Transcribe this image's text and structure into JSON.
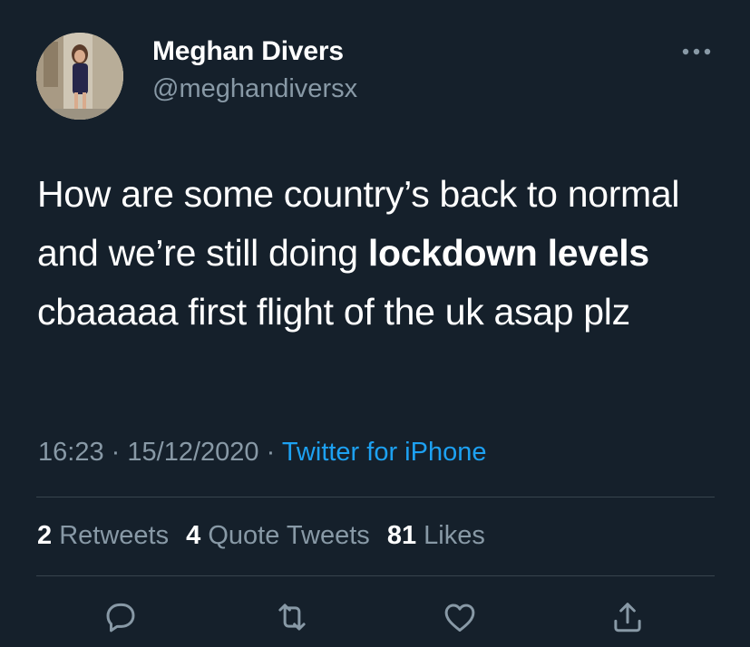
{
  "author": {
    "display_name": "Meghan Divers",
    "handle": "@meghandiversx",
    "avatar_icon": "profile-photo"
  },
  "tweet": {
    "text_segments": [
      {
        "text": "How are some country’s back to normal and we’re still doing ",
        "bold": false
      },
      {
        "text": "lockdown levels",
        "bold": true
      },
      {
        "text": " cbaaaaa first flight of the uk asap plz",
        "bold": false
      }
    ]
  },
  "meta": {
    "time": "16:23",
    "separator": "·",
    "date": "15/12/2020",
    "source": "Twitter for iPhone"
  },
  "stats": {
    "retweets_count": "2",
    "retweets_label": "Retweets",
    "quotes_count": "4",
    "quotes_label": "Quote Tweets",
    "likes_count": "81",
    "likes_label": "Likes"
  },
  "actions": {
    "reply_icon": "reply-icon",
    "retweet_icon": "retweet-icon",
    "like_icon": "heart-icon",
    "share_icon": "share-icon"
  },
  "colors": {
    "background": "#15202b",
    "primary_text": "#ffffff",
    "secondary_text": "#8899a6",
    "accent": "#1da1f2",
    "divider": "#38444d"
  }
}
